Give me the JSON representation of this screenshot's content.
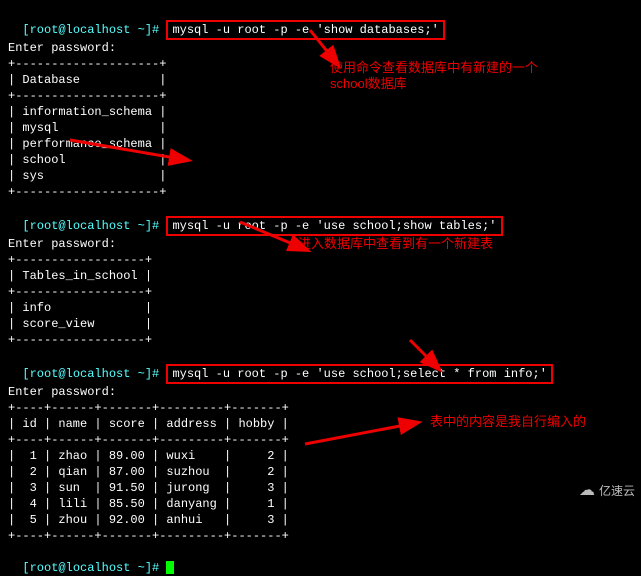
{
  "prompt1": {
    "user_host": "[root@localhost ~]# ",
    "cmd": "mysql -u root -p -e 'show databases;'"
  },
  "enter_pw": "Enter password:",
  "sep_db": "+--------------------+",
  "db_header": "| Database           |",
  "dbs": [
    "| information_schema |",
    "| mysql              |",
    "| performance_schema |",
    "| school             |",
    "| sys                |"
  ],
  "prompt2": {
    "user_host": "[root@localhost ~]# ",
    "cmd": "mysql -u root -p -e 'use school;show tables;'"
  },
  "sep_tbl": "+------------------+",
  "tbl_header": "| Tables_in_school |",
  "tbls": [
    "| info             |",
    "| score_view       |"
  ],
  "prompt3": {
    "user_host": "[root@localhost ~]# ",
    "cmd": "mysql -u root -p -e 'use school;select * from info;'"
  },
  "sep_info": "+----+------+-------+---------+-------+",
  "info_header": "| id | name | score | address | hobby |",
  "rows": [
    "|  1 | zhao | 89.00 | wuxi    |     2 |",
    "|  2 | qian | 87.00 | suzhou  |     2 |",
    "|  3 | sun  | 91.50 | jurong  |     3 |",
    "|  4 | lili | 85.50 | danyang |     1 |",
    "|  5 | zhou | 92.00 | anhui   |     3 |"
  ],
  "prompt_end": "[root@localhost ~]# ",
  "annotations": {
    "a1_l1": "使用命令查看数据库中有新建的一个",
    "a1_l2": "school数据库",
    "a2": "进入数据库中查看到有一个新建表",
    "a3": "表中的内容是我自行编入的"
  },
  "watermark": "亿速云"
}
